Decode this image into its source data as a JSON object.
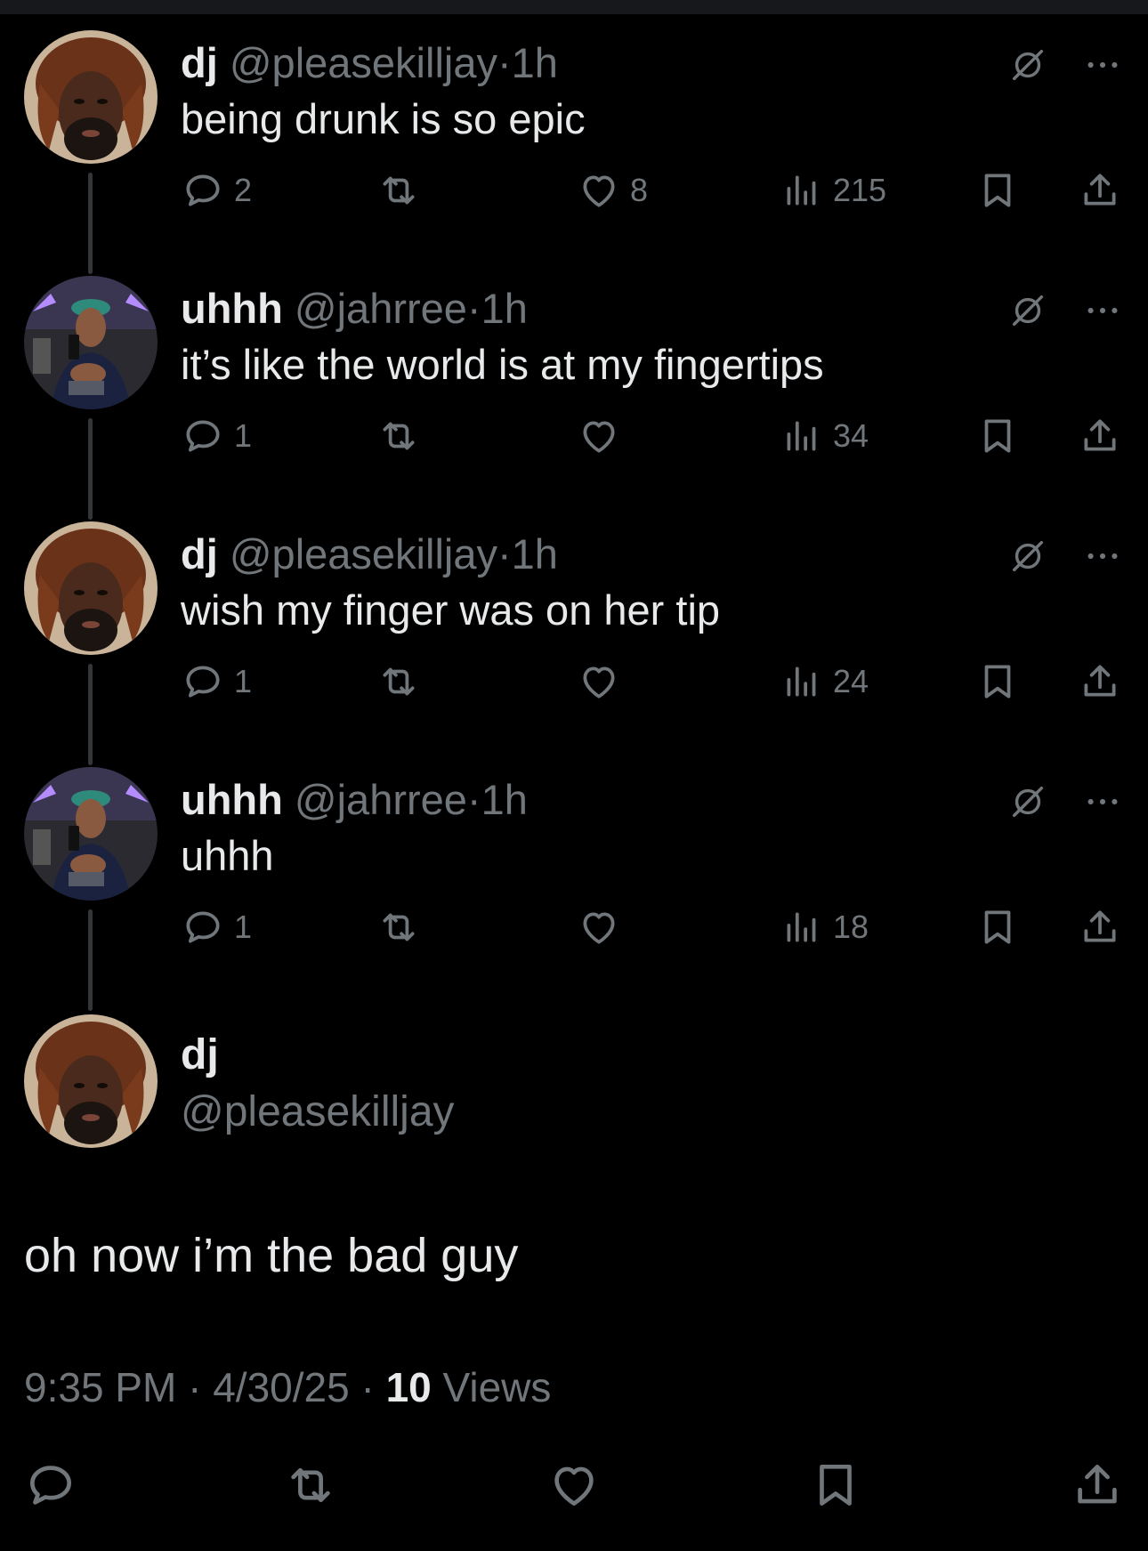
{
  "thread": [
    {
      "name": "dj",
      "handle": "@pleasekilljay",
      "time": "1h",
      "text": "being drunk is so epic",
      "replies": "2",
      "retweets": "",
      "likes": "8",
      "views": "215"
    },
    {
      "name": "uhhh",
      "handle": "@jahrree",
      "time": "1h",
      "text": "it’s like the world is at my fingertips",
      "replies": "1",
      "retweets": "",
      "likes": "",
      "views": "34"
    },
    {
      "name": "dj",
      "handle": "@pleasekilljay",
      "time": "1h",
      "text": "wish my finger was on her tip",
      "replies": "1",
      "retweets": "",
      "likes": "",
      "views": "24"
    },
    {
      "name": "uhhh",
      "handle": "@jahrree",
      "time": "1h",
      "text": "uhhh",
      "replies": "1",
      "retweets": "",
      "likes": "",
      "views": "18"
    }
  ],
  "main": {
    "name": "dj",
    "handle": "@pleasekilljay",
    "text": "oh now i’m the bad guy",
    "time": "9:35 PM",
    "date": "4/30/25",
    "views_count": "10",
    "views_label": "Views"
  },
  "separator": "·",
  "icons": {
    "reply": "reply-icon",
    "retweet": "retweet-icon",
    "like": "heart-icon",
    "views": "views-icon",
    "bookmark": "bookmark-icon",
    "share": "share-icon",
    "grok": "grok-icon",
    "more": "more-icon"
  },
  "colors": {
    "background": "#000000",
    "text": "#e7e9ea",
    "muted": "#71767b",
    "thread_line": "#333639"
  }
}
